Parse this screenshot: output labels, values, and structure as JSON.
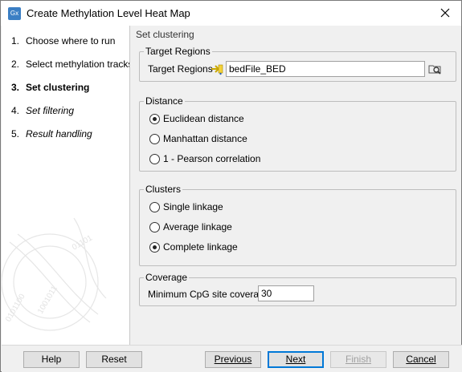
{
  "window": {
    "title": "Create Methylation Level Heat Map",
    "app_icon_text": "Gx"
  },
  "steps": [
    {
      "num": "1.",
      "label": "Choose where to run"
    },
    {
      "num": "2.",
      "label": "Select methylation tracks"
    },
    {
      "num": "3.",
      "label": "Set clustering"
    },
    {
      "num": "4.",
      "label": "Set filtering"
    },
    {
      "num": "5.",
      "label": "Result handling"
    }
  ],
  "panel": {
    "section_title": "Set clustering",
    "target_regions": {
      "group_label": "Target Regions",
      "field_label": "Target Regions",
      "value": "bedFile_BED"
    },
    "distance": {
      "group_label": "Distance",
      "options": [
        "Euclidean distance",
        "Manhattan distance",
        "1 - Pearson correlation"
      ],
      "selected": "Euclidean distance"
    },
    "clusters": {
      "group_label": "Clusters",
      "options": [
        "Single linkage",
        "Average linkage",
        "Complete linkage"
      ],
      "selected": "Complete linkage"
    },
    "coverage": {
      "group_label": "Coverage",
      "field_label": "Minimum CpG site coverage",
      "value": "30"
    }
  },
  "buttons": {
    "help": "Help",
    "reset": "Reset",
    "previous": "Previous",
    "next": "Next",
    "finish": "Finish",
    "cancel": "Cancel"
  },
  "colors": {
    "accent": "#0078d7",
    "app_icon": "#3b7fc4"
  }
}
